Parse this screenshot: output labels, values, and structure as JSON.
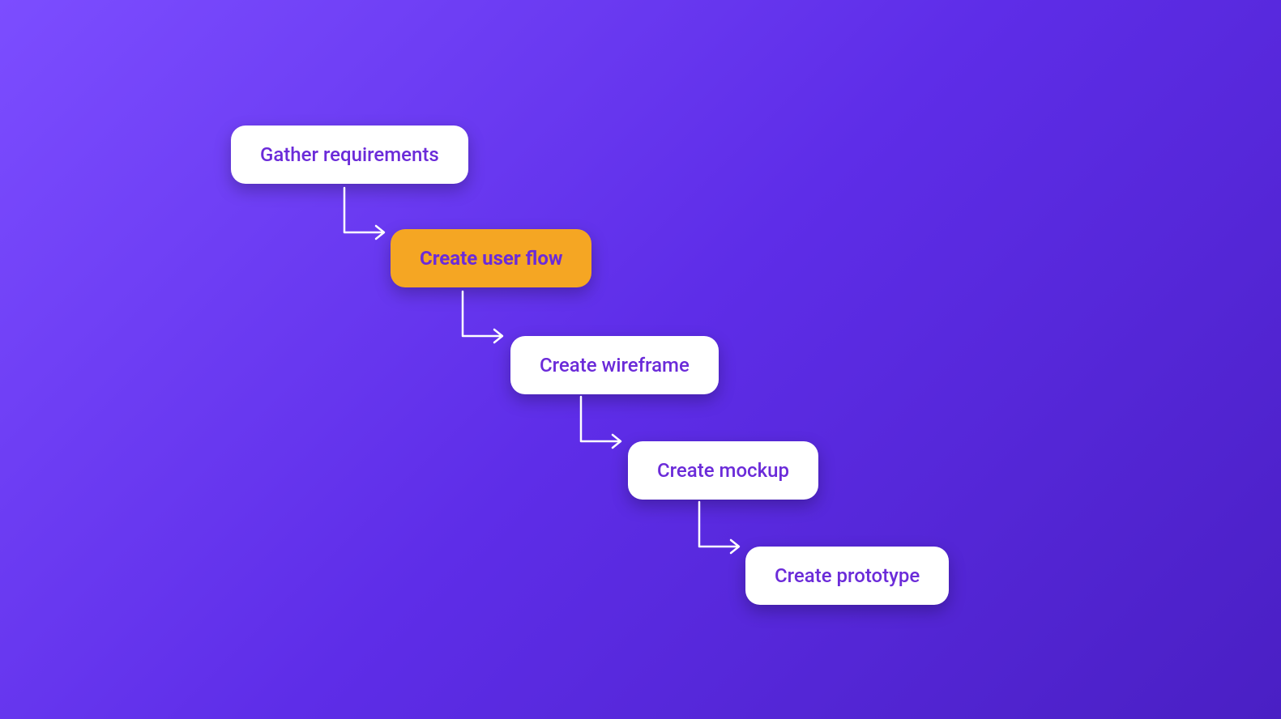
{
  "diagram": {
    "steps": [
      {
        "label": "Gather requirements",
        "highlighted": false
      },
      {
        "label": "Create user flow",
        "highlighted": true
      },
      {
        "label": "Create wireframe",
        "highlighted": false
      },
      {
        "label": "Create mockup",
        "highlighted": false
      },
      {
        "label": "Create prototype",
        "highlighted": false
      }
    ],
    "colors": {
      "background_gradient_start": "#7c4dff",
      "background_gradient_end": "#4a1fc4",
      "box_default_bg": "#ffffff",
      "box_highlight_bg": "#f5a623",
      "text_color": "#6b2bd9",
      "arrow_color": "#ffffff"
    }
  }
}
